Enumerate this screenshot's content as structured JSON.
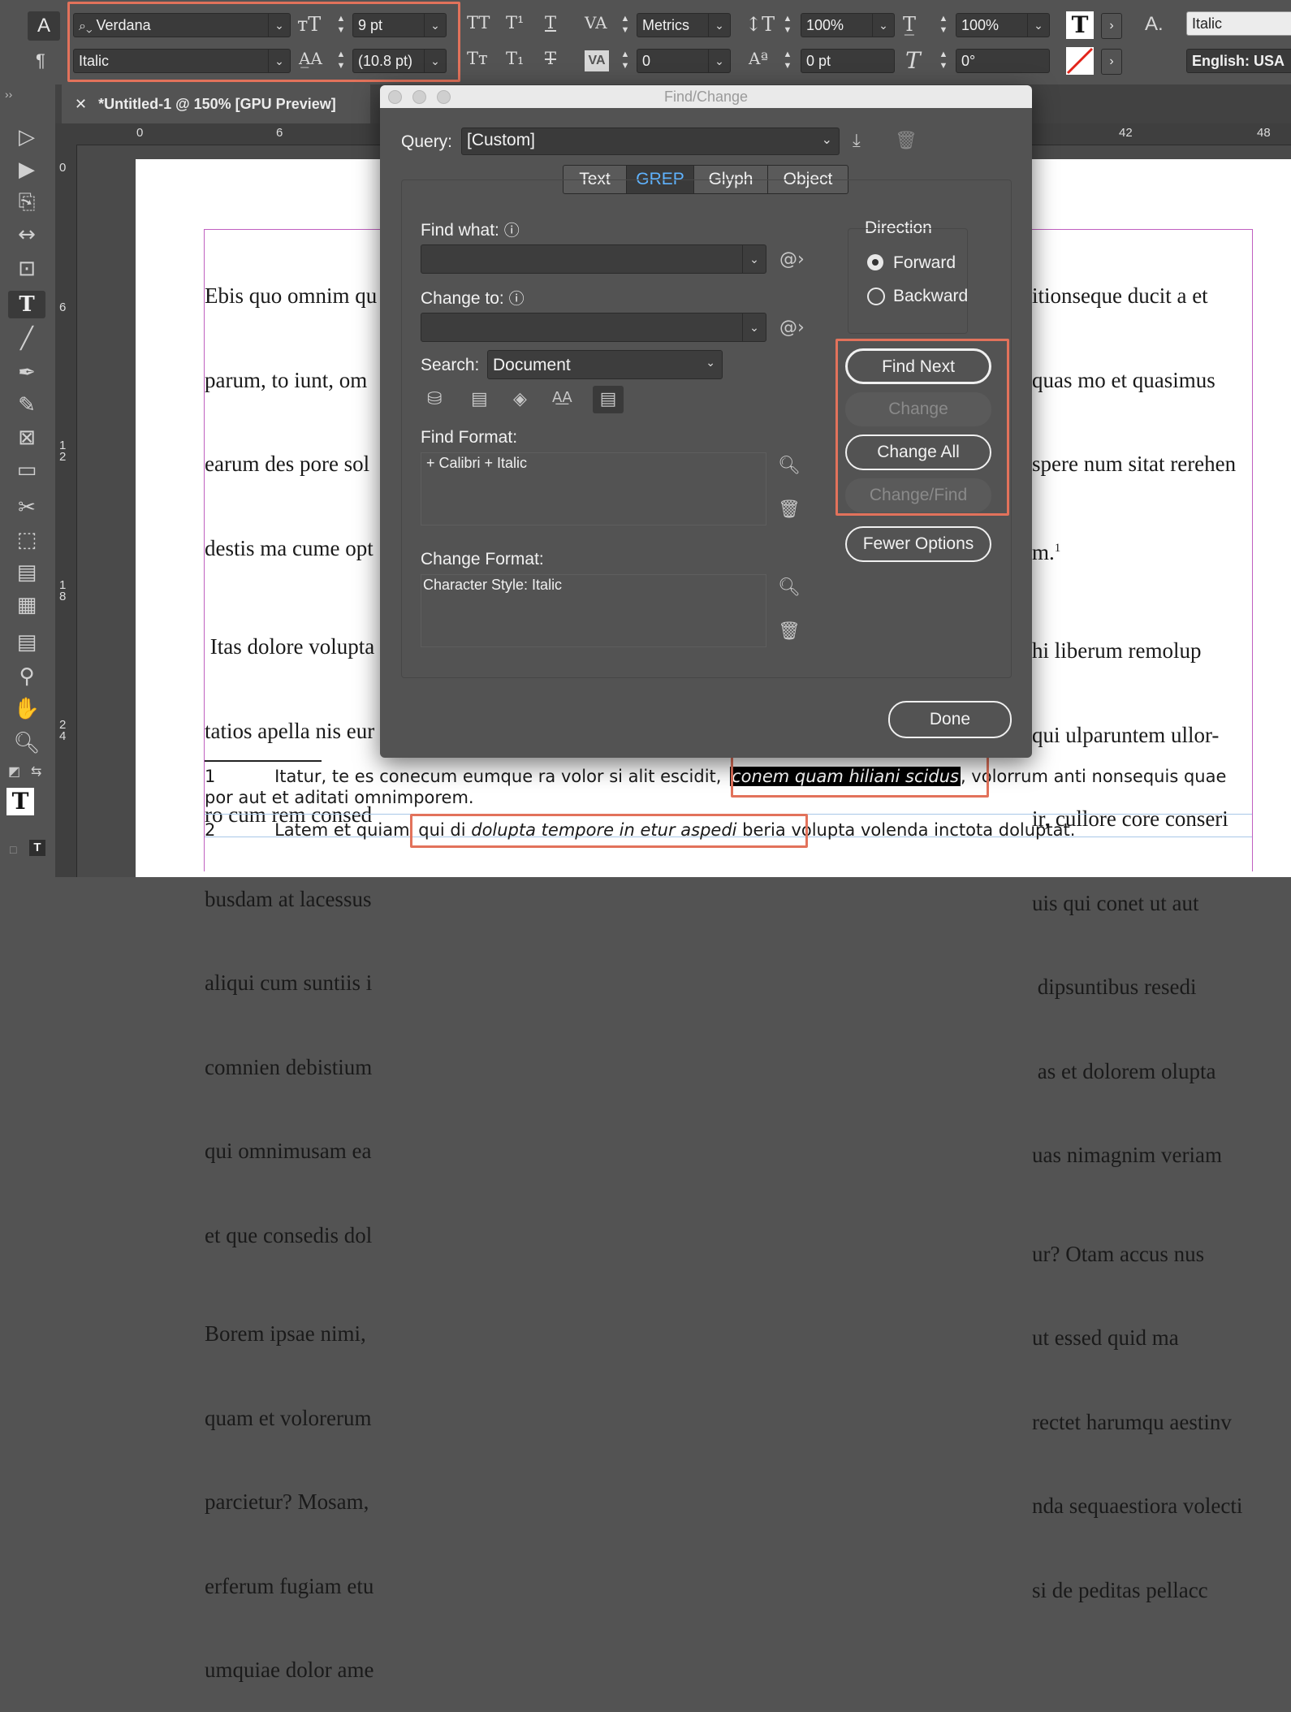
{
  "control_bar": {
    "font_family": "Verdana",
    "font_style": "Italic",
    "font_size": "9 pt",
    "leading": "(10.8 pt)",
    "kerning": "Metrics",
    "tracking": "0",
    "vertical_scale": "100%",
    "horizontal_scale": "100%",
    "baseline_shift": "0 pt",
    "skew": "0°",
    "char_style": "Italic",
    "language": "English: USA"
  },
  "document": {
    "tab_title": "*Untitled-1 @ 150% [GPU Preview]",
    "ruler_top": [
      "0",
      "6",
      "42",
      "48"
    ],
    "ruler_left": [
      "0",
      "6",
      "1\n2",
      "1\n8",
      "2\n4"
    ],
    "left_column": [
      "Ebis quo omnim qu",
      "parum, to iunt, om",
      "earum des pore sol",
      "destis ma cume opt",
      " Itas dolore volupta",
      "tatios apella nis eur",
      "ro cum rem consed",
      "busdam at lacessus",
      "aliqui cum suntiis i",
      "comnien debistium",
      "qui omnimusam ea",
      "et que consedis dol",
      "Borem ipsae nimi,",
      "quam et volorerum",
      "parcietur? Mosam,",
      "erferum fugiam etu",
      "umquiae dolor ame"
    ],
    "right_column": [
      "itionseque ducit a et",
      "quas mo et quasimus",
      "spere num sitat rerehen",
      "m.",
      "hi liberum remolup",
      "qui ulparuntem ullor-",
      "ir, cullore core conseri",
      "uis qui conet ut aut",
      " dipsuntibus resedi",
      " as et dolorem olupta",
      "uas nimagnim veriam",
      "ur? Otam accus nus",
      "ut essed quid ma",
      "rectet harumqu aestinv",
      "nda sequaestiora volecti",
      "si de peditas pellacc"
    ],
    "footnote_marker": "1",
    "footnotes": {
      "fn1_number": "1",
      "fn1_before": "Itatur, te es conecum eumque ra volor si alit escidit,",
      "fn1_highlight": "conem quam hiliani scidus",
      "fn1_after": ", volorrum anti nonsequis quae",
      "fn1_line2": "por aut et aditati omnimporem.",
      "fn2_number": "2",
      "fn2_before": "Latem et quiam",
      "fn2_mid1": "qui di ",
      "fn2_italic": "dolupta tempore in etur aspedi",
      "fn2_mid2": " beria",
      "fn2_after": " volupta volenda inctota doluptat."
    }
  },
  "find_change": {
    "title": "Find/Change",
    "query_label": "Query:",
    "query_value": "[Custom]",
    "tabs": [
      "Text",
      "GREP",
      "Glyph",
      "Object"
    ],
    "active_tab": "GREP",
    "find_what_label": "Find what:",
    "find_what_value": "",
    "change_to_label": "Change to:",
    "change_to_value": "",
    "search_label": "Search:",
    "search_value": "Document",
    "find_format_label": "Find Format:",
    "find_format_value": "+ Calibri + Italic",
    "change_format_label": "Change Format:",
    "change_format_value": "Character Style: Italic",
    "direction_label": "Direction",
    "direction_forward": "Forward",
    "direction_backward": "Backward",
    "direction_selected": "Forward",
    "buttons": {
      "find_next": "Find Next",
      "change": "Change",
      "change_all": "Change All",
      "change_find": "Change/Find",
      "fewer_options": "Fewer Options",
      "done": "Done"
    }
  },
  "colors": {
    "highlight": "#e2725b",
    "active_tab_text": "#5fb3ff"
  }
}
